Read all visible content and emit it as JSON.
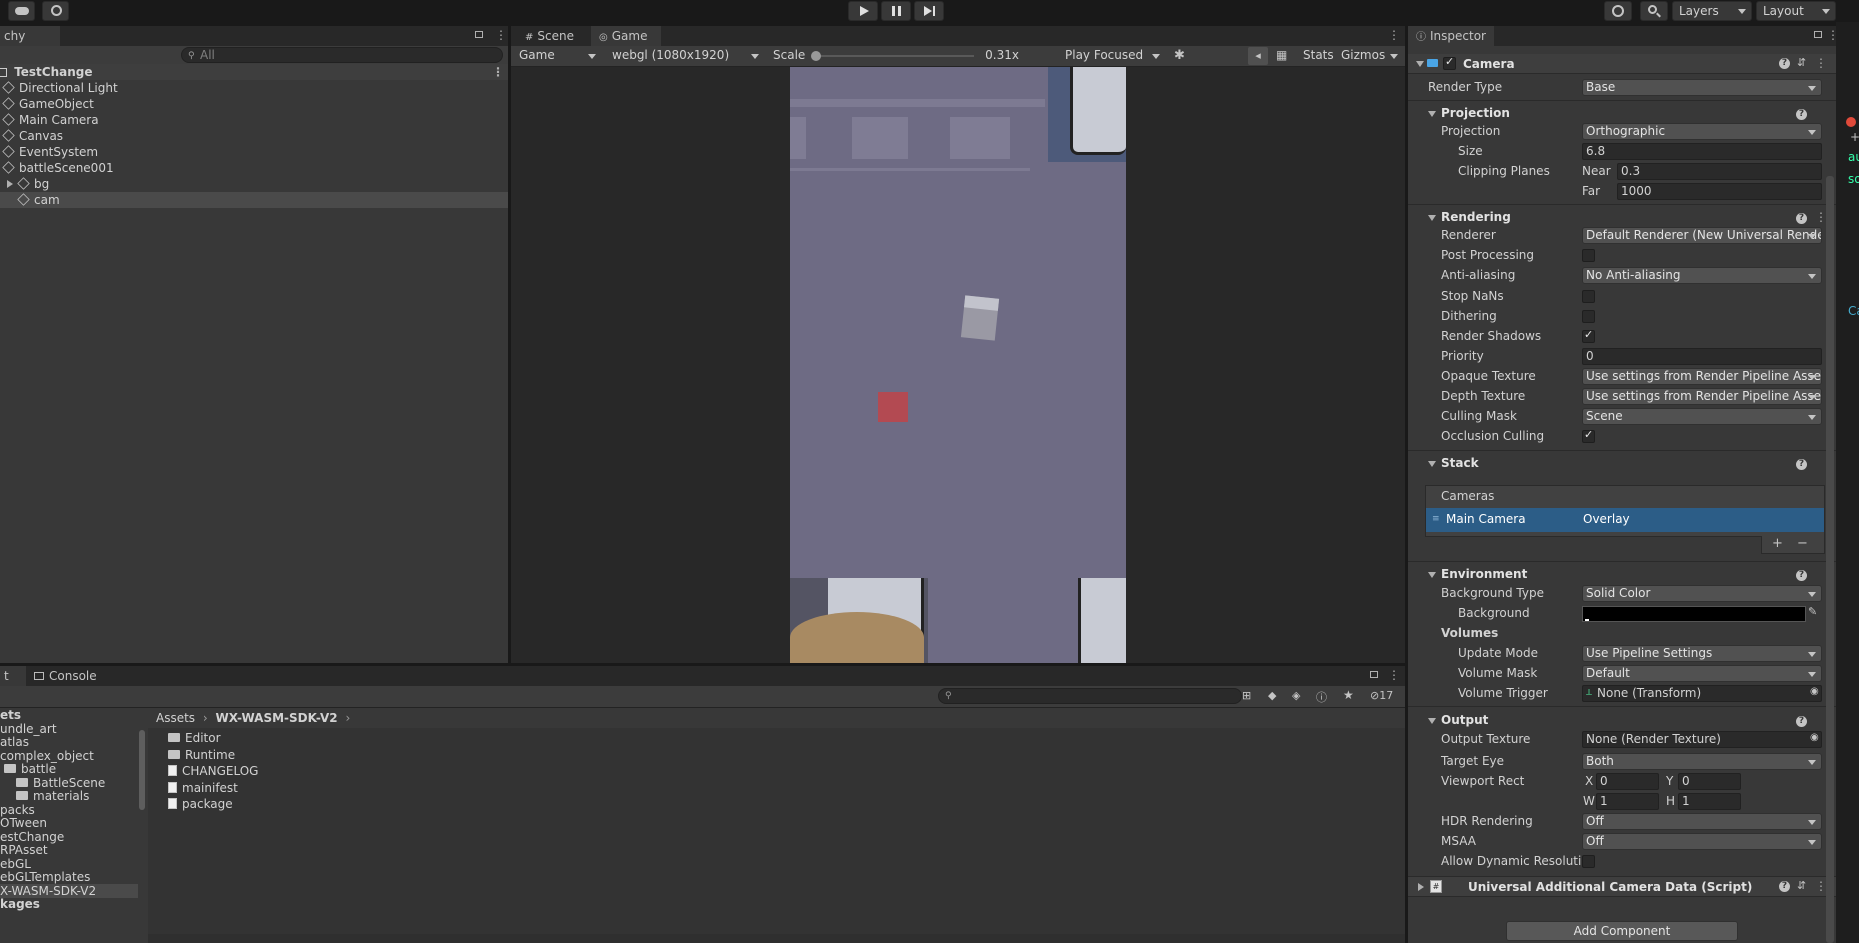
{
  "toolbar": {
    "layers": "Layers",
    "layout": "Layout",
    "play_icon": "play-icon",
    "pause_icon": "pause-icon",
    "step_icon": "step-icon"
  },
  "hierarchy": {
    "tab": "chy",
    "search_placeholder": "All",
    "scene": "TestChange",
    "items": [
      {
        "label": "Directional Light"
      },
      {
        "label": "GameObject"
      },
      {
        "label": "Main Camera"
      },
      {
        "label": "Canvas"
      },
      {
        "label": "EventSystem"
      },
      {
        "label": "battleScene001"
      },
      {
        "label": "bg"
      },
      {
        "label": "cam"
      }
    ]
  },
  "game_view": {
    "tab_scene": "Scene",
    "tab_game": "Game",
    "display": "Game",
    "resolution": "webgl (1080x1920)",
    "scale_label": "Scale",
    "scale_value": "0.31x",
    "play_mode": "Play Focused",
    "stats": "Stats",
    "gizmos": "Gizmos"
  },
  "project": {
    "tab_project": "t",
    "tab_console": "Console",
    "hidden_count": "17",
    "breadcrumb": [
      "Assets",
      "WX-WASM-SDK-V2"
    ],
    "tree": [
      {
        "label": "ets",
        "indent": 0
      },
      {
        "label": "undle_art",
        "indent": 0
      },
      {
        "label": "atlas",
        "indent": 0
      },
      {
        "label": "complex_object",
        "indent": 0
      },
      {
        "label": "battle",
        "indent": 1
      },
      {
        "label": "BattleScene",
        "indent": 2
      },
      {
        "label": "materials",
        "indent": 2
      },
      {
        "label": "packs",
        "indent": 0
      },
      {
        "label": "OTween",
        "indent": 0
      },
      {
        "label": "estChange",
        "indent": 0
      },
      {
        "label": "RPAsset",
        "indent": 0
      },
      {
        "label": "ebGL",
        "indent": 0
      },
      {
        "label": "ebGLTemplates",
        "indent": 0
      },
      {
        "label": "X-WASM-SDK-V2",
        "indent": 0
      },
      {
        "label": "kages",
        "indent": 0
      }
    ],
    "files": [
      {
        "label": "Editor",
        "kind": "folder"
      },
      {
        "label": "Runtime",
        "kind": "folder"
      },
      {
        "label": "CHANGELOG",
        "kind": "doc"
      },
      {
        "label": "mainifest",
        "kind": "doc"
      },
      {
        "label": "package",
        "kind": "doc"
      }
    ]
  },
  "inspector": {
    "tab": "Inspector",
    "component": "Camera",
    "render_type_label": "Render Type",
    "render_type": "Base",
    "projection": {
      "header": "Projection",
      "projection_label": "Projection",
      "projection": "Orthographic",
      "size_label": "Size",
      "size": "6.8",
      "clipping_label": "Clipping Planes",
      "near_label": "Near",
      "near": "0.3",
      "far_label": "Far",
      "far": "1000"
    },
    "rendering": {
      "header": "Rendering",
      "renderer_label": "Renderer",
      "renderer": "Default Renderer (New Universal Render",
      "post_label": "Post Processing",
      "aa_label": "Anti-aliasing",
      "aa": "No Anti-aliasing",
      "nans_label": "Stop NaNs",
      "dither_label": "Dithering",
      "shadows_label": "Render Shadows",
      "priority_label": "Priority",
      "priority": "0",
      "opaque_label": "Opaque Texture",
      "opaque": "Use settings from Render Pipeline Asset",
      "depth_label": "Depth Texture",
      "depth": "Use settings from Render Pipeline Asset",
      "mask_label": "Culling Mask",
      "mask": "Scene",
      "occlusion_label": "Occlusion Culling"
    },
    "stack": {
      "header": "Stack",
      "list_header": "Cameras",
      "item_name": "Main Camera",
      "item_type": "Overlay"
    },
    "environment": {
      "header": "Environment",
      "bg_type_label": "Background Type",
      "bg_type": "Solid Color",
      "bg_label": "Background",
      "bg_color": "#000000",
      "volumes_label": "Volumes",
      "update_label": "Update Mode",
      "update": "Use Pipeline Settings",
      "vmask_label": "Volume Mask",
      "vmask": "Default",
      "trigger_label": "Volume Trigger",
      "trigger": "None (Transform)"
    },
    "output": {
      "header": "Output",
      "texture_label": "Output Texture",
      "texture": "None (Render Texture)",
      "eye_label": "Target Eye",
      "eye": "Both",
      "viewport_label": "Viewport Rect",
      "x_label": "X",
      "x": "0",
      "y_label": "Y",
      "y": "0",
      "w_label": "W",
      "w": "1",
      "h_label": "H",
      "h": "1",
      "hdr_label": "HDR Rendering",
      "hdr": "Off",
      "msaa_label": "MSAA",
      "msaa": "Off",
      "dyn_label": "Allow Dynamic Resolutio"
    },
    "script_component": "Universal Additional Camera Data (Script)",
    "add_component": "Add Component"
  },
  "colors": {
    "selection": "#2c5d87",
    "game_bg": "#6e6b84",
    "accent_icon": "#4aa5e6"
  }
}
